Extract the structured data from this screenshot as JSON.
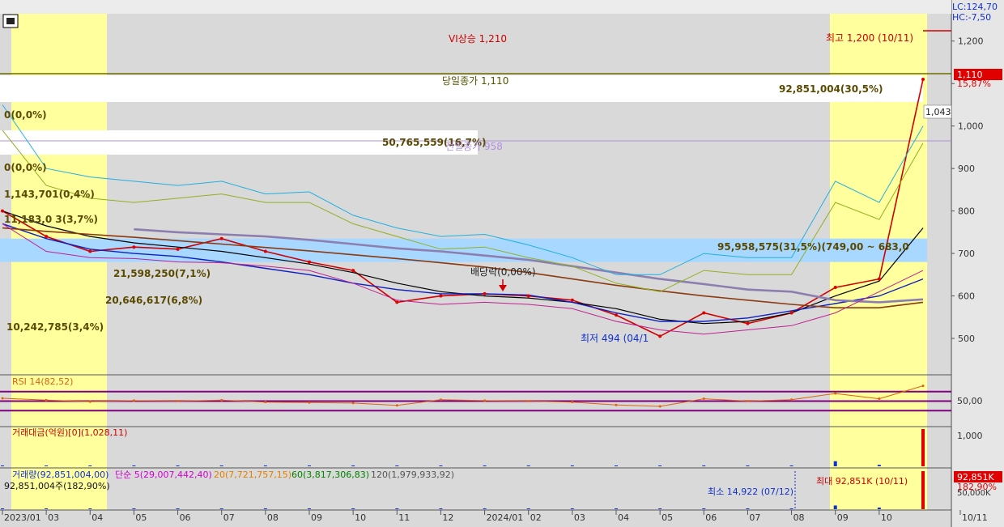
{
  "colors": {
    "background": "#d9d9d9",
    "highlight_band": "#ffff9e",
    "price_band": "#a8d8ff",
    "up": "#e00000",
    "down": "#1030d0",
    "rsi_line": "#e06010",
    "rsi_level": "#800080",
    "ma_long": "#8c7fb0",
    "ma_brown": "#8b3a10",
    "ma_blue": "#1020c0"
  },
  "header": {
    "lc": "LC:124,70",
    "hc": "HC:-7,50"
  },
  "chart_data": [
    {
      "type": "line",
      "name": "price",
      "x": [
        "2023-01",
        "2023-02",
        "2023-03",
        "2023-04",
        "2023-05",
        "2023-06",
        "2023-07",
        "2023-08",
        "2023-09",
        "2023-10",
        "2023-11",
        "2023-12",
        "2024-01",
        "2024-02",
        "2024-03",
        "2024-04",
        "2024-05",
        "2024-06",
        "2024-07",
        "2024-08",
        "2024-09",
        "2024-10"
      ],
      "x_tick_labels": [
        "2023/01",
        "03",
        "04",
        "05",
        "06",
        "07",
        "08",
        "09",
        "10",
        "11",
        "12",
        "2024/01",
        "02",
        "03",
        "04",
        "05",
        "06",
        "07",
        "08",
        "09",
        "10",
        "10/11"
      ],
      "ylim": [
        420,
        1230
      ],
      "y_ticks": [
        "1,200",
        "1,100",
        "1,000",
        "900",
        "800",
        "700",
        "600",
        "500"
      ],
      "series": [
        {
          "values": [
            800,
            740,
            705,
            715,
            710,
            735,
            705,
            680,
            660,
            585,
            600,
            605,
            600,
            590,
            555,
            505,
            560,
            535,
            560,
            620,
            640,
            1110
          ]
        },
        {
          "values": [
            800,
            765,
            740,
            725,
            715,
            705,
            690,
            675,
            655,
            630,
            610,
            600,
            595,
            585,
            570,
            545,
            535,
            540,
            560,
            600,
            635,
            760
          ]
        },
        {
          "values": [
            770,
            735,
            710,
            700,
            693,
            680,
            665,
            650,
            630,
            615,
            605,
            605,
            602,
            585,
            560,
            540,
            540,
            548,
            565,
            582,
            600,
            640
          ]
        },
        {
          "values": [
            760,
            752,
            745,
            738,
            730,
            722,
            714,
            706,
            697,
            688,
            678,
            668,
            655,
            640,
            625,
            612,
            600,
            590,
            580,
            572,
            572,
            585
          ]
        },
        {
          "values": [
            790,
            775,
            765,
            757,
            750,
            745,
            740,
            732,
            722,
            712,
            705,
            695,
            685,
            670,
            655,
            640,
            628,
            615,
            610,
            590,
            585,
            592
          ]
        },
        {
          "values": [
            1050,
            900,
            880,
            870,
            860,
            870,
            840,
            845,
            790,
            760,
            740,
            745,
            720,
            690,
            650,
            650,
            700,
            690,
            690,
            870,
            820,
            1000
          ]
        },
        {
          "values": [
            990,
            860,
            830,
            820,
            830,
            840,
            820,
            820,
            770,
            740,
            710,
            715,
            690,
            670,
            630,
            610,
            660,
            650,
            650,
            820,
            780,
            960
          ]
        },
        {
          "values": [
            770,
            705,
            690,
            688,
            680,
            678,
            670,
            660,
            630,
            590,
            580,
            585,
            580,
            570,
            540,
            520,
            510,
            520,
            530,
            560,
            610,
            660
          ]
        }
      ],
      "annotations": {
        "rise": "VI상승 1,210",
        "today_close": "당일종가 1,110",
        "prev_close": "전일종가 958",
        "high": "최고 1,200 (10/11)",
        "low": "최저 494 (04/1",
        "dividend": "배당락(0,00%)",
        "price_tag": "1,110",
        "change_pct": "15,87%",
        "side_price": "1,043"
      },
      "volume_profile": [
        {
          "label": "92,851,004(30,5%)"
        },
        {
          "label": "50,765,559(16,7%)"
        },
        {
          "label": "0(0,0%)"
        },
        {
          "label": "0(0,0%)"
        },
        {
          "label": "1,143,701(0,4%)"
        },
        {
          "label": "11,183,0 3(3,7%)"
        },
        {
          "label": "95,958,575(31,5%)(749,00 ~ 683,0"
        },
        {
          "label": "21,598,250(7,1%)"
        },
        {
          "label": "20,646,617(6,8%)"
        },
        {
          "label": "10,242,785(3,4%)"
        }
      ]
    },
    {
      "type": "line",
      "name": "RSI",
      "label": "RSI 14(82,52)",
      "y_ticks": [
        "50,00"
      ],
      "values": [
        56,
        52,
        49,
        51,
        50,
        52,
        48,
        47,
        46,
        41,
        53,
        51,
        50,
        48,
        42,
        39,
        55,
        50,
        53,
        66,
        55,
        82
      ]
    },
    {
      "type": "bar",
      "name": "trading_value",
      "label": "거래대금(억원)[0](1,028,11)",
      "y_ticks": [
        "1,000"
      ],
      "values": [
        10,
        8,
        6,
        7,
        6,
        8,
        6,
        9,
        5,
        4,
        6,
        6,
        5,
        5,
        4,
        6,
        7,
        6,
        7,
        140,
        40,
        1028
      ]
    },
    {
      "type": "bar",
      "name": "volume",
      "legend": [
        "거래량(92,851,004,00)",
        "단순 5(29,007,442,40)",
        "20(7,721,757,15)",
        "60(3,817,306,83)",
        "120(1,979,933,92)"
      ],
      "sub_label": "92,851,004주(182,90%)",
      "min_label": "최소 14,922 (07/12)",
      "max_label": "최대 92,851K (10/11)",
      "y_ticks": [
        "50,000K"
      ],
      "right_tags": [
        "92,851K",
        "182,90%"
      ],
      "values": [
        1.5,
        1.2,
        0.9,
        1.0,
        0.9,
        1.2,
        0.9,
        1.3,
        0.8,
        0.6,
        0.9,
        0.9,
        0.8,
        0.8,
        0.6,
        0.9,
        1.0,
        0.9,
        0.3,
        9,
        4,
        92.85
      ]
    }
  ]
}
